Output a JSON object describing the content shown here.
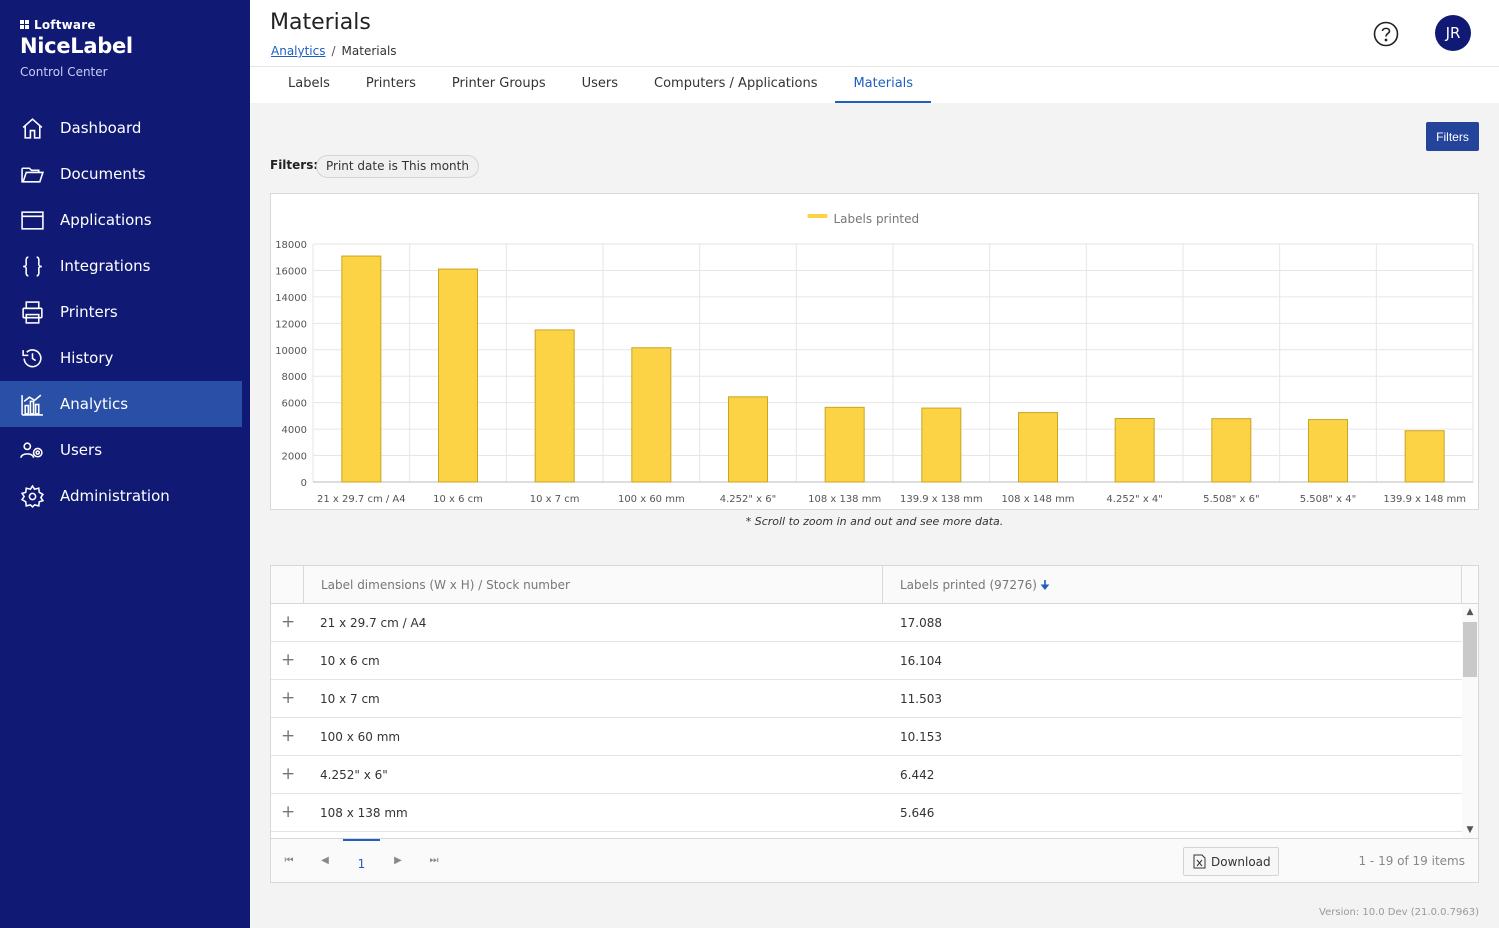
{
  "brand": {
    "company": "Loftware",
    "product": "NiceLabel",
    "subtitle": "Control Center"
  },
  "sidebar": {
    "items": [
      {
        "label": "Dashboard",
        "icon": "home-icon"
      },
      {
        "label": "Documents",
        "icon": "folder-icon"
      },
      {
        "label": "Applications",
        "icon": "window-icon"
      },
      {
        "label": "Integrations",
        "icon": "braces-icon"
      },
      {
        "label": "Printers",
        "icon": "printer-icon"
      },
      {
        "label": "History",
        "icon": "history-icon"
      },
      {
        "label": "Analytics",
        "icon": "analytics-icon",
        "active": true
      },
      {
        "label": "Users",
        "icon": "users-icon"
      },
      {
        "label": "Administration",
        "icon": "gear-icon"
      }
    ]
  },
  "header": {
    "title": "Materials",
    "breadcrumb": {
      "parent": "Analytics",
      "current": "Materials",
      "separator": "/"
    },
    "avatar_initials": "JR"
  },
  "tabs": [
    {
      "label": "Labels"
    },
    {
      "label": "Printers"
    },
    {
      "label": "Printer Groups"
    },
    {
      "label": "Users"
    },
    {
      "label": "Computers / Applications"
    },
    {
      "label": "Materials",
      "active": true
    }
  ],
  "filters": {
    "button_label": "Filters",
    "label": "Filters:",
    "chips": [
      "Print date is This month"
    ]
  },
  "chart_data": {
    "type": "bar",
    "categories": [
      "21 x 29.7 cm / A4",
      "10 x 6 cm",
      "10 x 7 cm",
      "100 x 60 mm",
      "4.252\" x 6\"",
      "108 x 138 mm",
      "139.9 x 138 mm",
      "108 x 148 mm",
      "4.252\" x 4\"",
      "5.508\" x 6\"",
      "5.508\" x 4\"",
      "139.9 x 148 mm"
    ],
    "series": [
      {
        "name": "Labels printed",
        "values": [
          17088,
          16104,
          11503,
          10153,
          6442,
          5646,
          5590,
          5250,
          4800,
          4790,
          4720,
          3880
        ]
      }
    ],
    "ylim": [
      0,
      18000
    ],
    "yticks": [
      0,
      2000,
      4000,
      6000,
      8000,
      10000,
      12000,
      14000,
      16000,
      18000
    ],
    "grid": true,
    "legend": "top-center",
    "bar_color": "#fdd346",
    "bar_border": "#c9a520"
  },
  "chart_note": "* Scroll to zoom in and out and see more data.",
  "grid": {
    "columns": [
      "Label dimensions (W x H) / Stock number",
      "Labels printed (97276)"
    ],
    "rows": [
      {
        "dimensions": "21 x 29.7 cm / A4",
        "printed": "17.088"
      },
      {
        "dimensions": "10 x 6 cm",
        "printed": "16.104"
      },
      {
        "dimensions": "10 x 7 cm",
        "printed": "11.503"
      },
      {
        "dimensions": "100 x 60 mm",
        "printed": "10.153"
      },
      {
        "dimensions": "4.252\" x 6\"",
        "printed": "6.442"
      },
      {
        "dimensions": "108 x 138 mm",
        "printed": "5.646"
      }
    ],
    "pager": {
      "current_page": "1",
      "download_label": "Download",
      "info": "1 - 19 of 19 items"
    }
  },
  "version": "Version: 10.0 Dev (21.0.0.7963)"
}
